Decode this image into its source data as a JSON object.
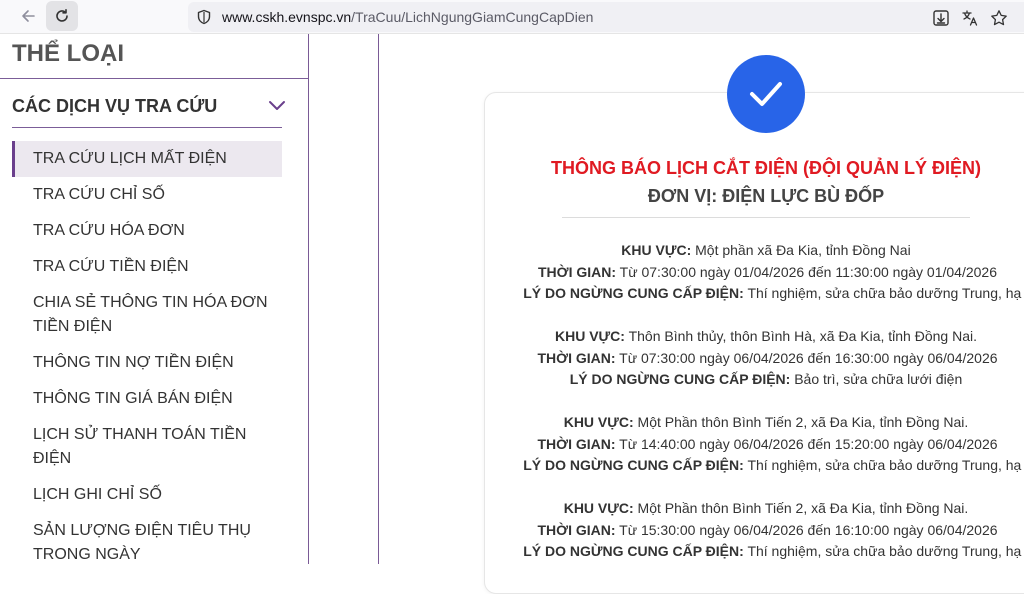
{
  "browser": {
    "url_host": "www.cskh.evnspc.vn",
    "url_path": "/TraCuu/LichNgungGiamCungCapDien"
  },
  "sidebar": {
    "category_title": "THỂ LOẠI",
    "group_title": "CÁC DỊCH VỤ TRA CỨU",
    "items": [
      {
        "label": "TRA CỨU LỊCH MẤT ĐIỆN",
        "active": true
      },
      {
        "label": "TRA CỨU CHỈ SỐ"
      },
      {
        "label": "TRA CỨU HÓA ĐƠN"
      },
      {
        "label": "TRA CỨU TIỀN ĐIỆN"
      },
      {
        "label": "CHIA SẺ THÔNG TIN HÓA ĐƠN TIỀN ĐIỆN"
      },
      {
        "label": "THÔNG TIN NỢ TIỀN ĐIỆN"
      },
      {
        "label": "THÔNG TIN GIÁ BÁN ĐIỆN"
      },
      {
        "label": "LỊCH SỬ THANH TOÁN TIỀN ĐIỆN"
      },
      {
        "label": "LỊCH GHI CHỈ SỐ"
      },
      {
        "label": "SẢN LƯỢNG ĐIỆN TIÊU THỤ TRONG NGÀY"
      }
    ]
  },
  "notice": {
    "title": "THÔNG BÁO LỊCH CẮT ĐIỆN (ĐỘI QUẢN LÝ ĐIỆN)",
    "unit": "ĐƠN VỊ: ĐIỆN LỰC BÙ ĐỐP",
    "labels": {
      "area": "KHU VỰC:",
      "time": "THỜI GIAN:",
      "reason": "LÝ DO NGỪNG CUNG CẤP ĐIỆN:"
    },
    "entries": [
      {
        "area": "Một phần xã Đa Kia, tỉnh Đồng Nai",
        "time": "Từ 07:30:00 ngày 01/04/2026 đến 11:30:00 ngày 01/04/2026",
        "reason": "Thí nghiệm, sửa chữa bảo dưỡng Trung, hạ áp"
      },
      {
        "area": "Thôn Bình thủy, thôn Bình Hà, xã Đa Kia, tỉnh Đồng Nai.",
        "time": "Từ 07:30:00 ngày 06/04/2026 đến 16:30:00 ngày 06/04/2026",
        "reason": "Bảo trì, sửa chữa lưới điện"
      },
      {
        "area": "Một Phần thôn Bình Tiến 2, xã Đa Kia, tỉnh Đồng Nai.",
        "time": "Từ 14:40:00 ngày 06/04/2026 đến 15:20:00 ngày 06/04/2026",
        "reason": "Thí nghiệm, sửa chữa bảo dưỡng Trung, hạ áp"
      },
      {
        "area": "Một Phần thôn Bình Tiến 2, xã Đa Kia, tỉnh Đồng Nai.",
        "time": "Từ 15:30:00 ngày 06/04/2026 đến 16:10:00 ngày 06/04/2026",
        "reason": "Thí nghiệm, sửa chữa bảo dưỡng Trung, hạ áp"
      }
    ]
  },
  "colors": {
    "accent_purple": "#6a3f8c",
    "title_red": "#e01a22",
    "check_blue": "#2864e8"
  },
  "icons": [
    "back-icon",
    "reload-icon",
    "shield-icon",
    "download-icon",
    "translate-icon",
    "star-icon",
    "chevron-down-icon",
    "checkmark-icon"
  ]
}
